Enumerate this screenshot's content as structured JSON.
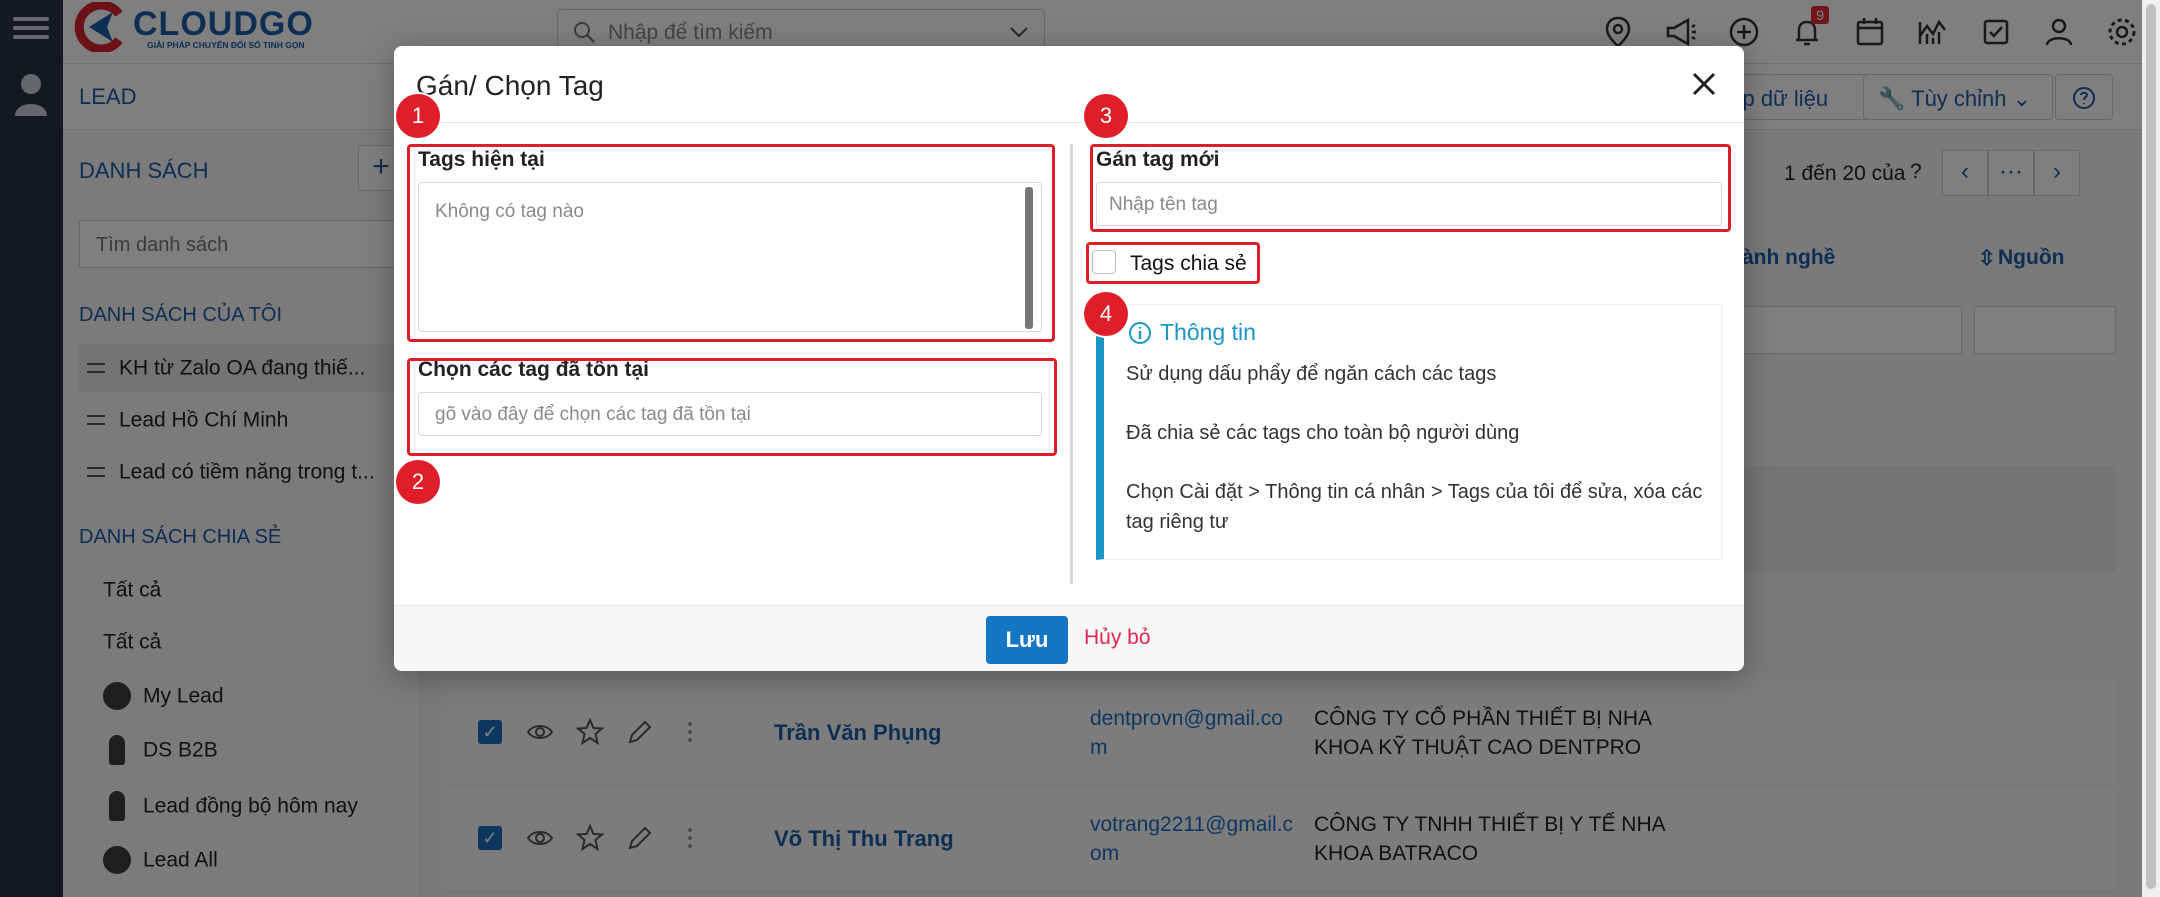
{
  "app": {
    "logo_word": "CLOUDGO",
    "logo_tagline": "GIẢI PHÁP CHUYỂN ĐỔI SỐ TINH GỌN",
    "search_placeholder": "Nhập để tìm kiếm",
    "notification_count": "9"
  },
  "header": {
    "title": "LEAD",
    "import_label": "hập dữ liệu",
    "customize_label": "Tùy chỉnh"
  },
  "sidebar": {
    "list_header": "DANH SÁCH",
    "add_label": "+",
    "search_placeholder": "Tìm danh sách",
    "my_lists_header": "DANH SÁCH CỦA TÔI",
    "my_lists": [
      "KH từ Zalo OA đang thiế...",
      "Lead Hồ Chí Minh",
      "Lead có tiềm năng trong t..."
    ],
    "shared_header": "DANH SÁCH CHIA SẺ",
    "shared_lists": [
      "Tất cả",
      "Tất cả",
      "My Lead",
      "DS B2B",
      "Lead đồng bộ hôm nay",
      "Lead All"
    ]
  },
  "table": {
    "pagination": "1 đến 20 của",
    "pagination_q": "?",
    "more_label": "···",
    "col_industry": "ành nghề",
    "col_source": "Nguồn",
    "rows": [
      {
        "name": "Trần Văn Phụng",
        "email": "dentprovn@gmail.com",
        "company": "CÔNG TY CỔ PHẦN THIẾT BỊ NHA KHOA KỸ THUẬT CAO DENTPRO"
      },
      {
        "name": "Võ Thị Thu Trang",
        "email": "votrang2211@gmail.com",
        "company": "CÔNG TY TNHH THIẾT BỊ Y TẾ NHA KHOA BATRACO"
      }
    ]
  },
  "modal": {
    "title": "Gán/ Chọn Tag",
    "current_tags_label": "Tags hiện tại",
    "current_tags_empty": "Không có tag nào",
    "existing_tags_label": "Chọn các tag đã tồn tại",
    "existing_tags_placeholder": "gõ vào đây để chọn các tag đã tồn tại",
    "new_tag_label": "Gán tag mới",
    "new_tag_placeholder": "Nhập tên tag",
    "shared_tags_label": "Tags chia sẻ",
    "shared_tags_checked": false,
    "info_title": "Thông tin",
    "info_lines": [
      "Sử dụng dấu phẩy để ngăn cách các tags",
      "Đã chia sẻ các tags cho toàn bộ người dùng",
      "Chọn Cài đặt > Thông tin cá nhân > Tags của tôi để sửa, xóa các tag riêng tư"
    ],
    "save_label": "Lưu",
    "cancel_label": "Hủy bỏ"
  },
  "annotations": [
    "1",
    "2",
    "3",
    "4"
  ],
  "colors": {
    "brand_blue": "#1d5ca8",
    "primary_button": "#1477c6",
    "cancel_link": "#e0284f",
    "info_accent": "#1996c4",
    "annotation_red": "#e01e2a"
  }
}
